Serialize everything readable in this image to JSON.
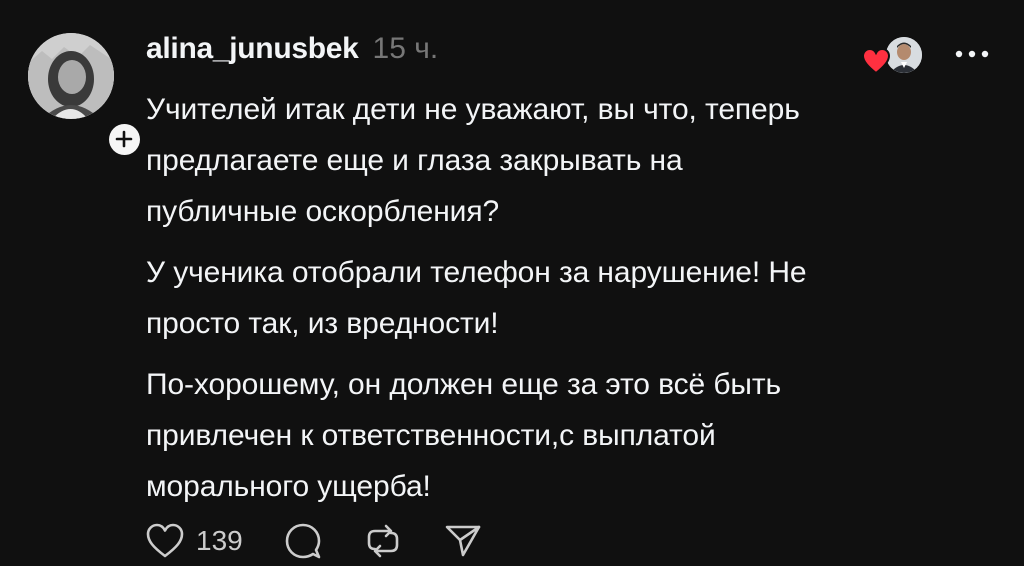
{
  "post": {
    "username": "alina_junusbek",
    "timestamp": "15 ч.",
    "paragraphs": [
      "Учителей итак дети не уважают, вы что, теперь\nпредлагаете еще и глаза закрывать на\nпубличные оскорбления?",
      "У ученика отобрали телефон за нарушение! Не\nпросто так, из вредности!",
      "По-хорошему, он должен еще за это всё быть\nпривлечен к ответственности,с выплатой\nморального ущерба!"
    ],
    "likes": "139"
  },
  "icons": {
    "follow": "plus-icon",
    "liked_by": "heart-icon",
    "more": "more-dots-icon",
    "like": "heart-outline-icon",
    "reply": "comment-icon",
    "repost": "repost-icon",
    "share": "send-icon"
  },
  "colors": {
    "background": "#101010",
    "text": "#f3f5f7",
    "muted": "#777777",
    "heart": "#ff3040"
  }
}
